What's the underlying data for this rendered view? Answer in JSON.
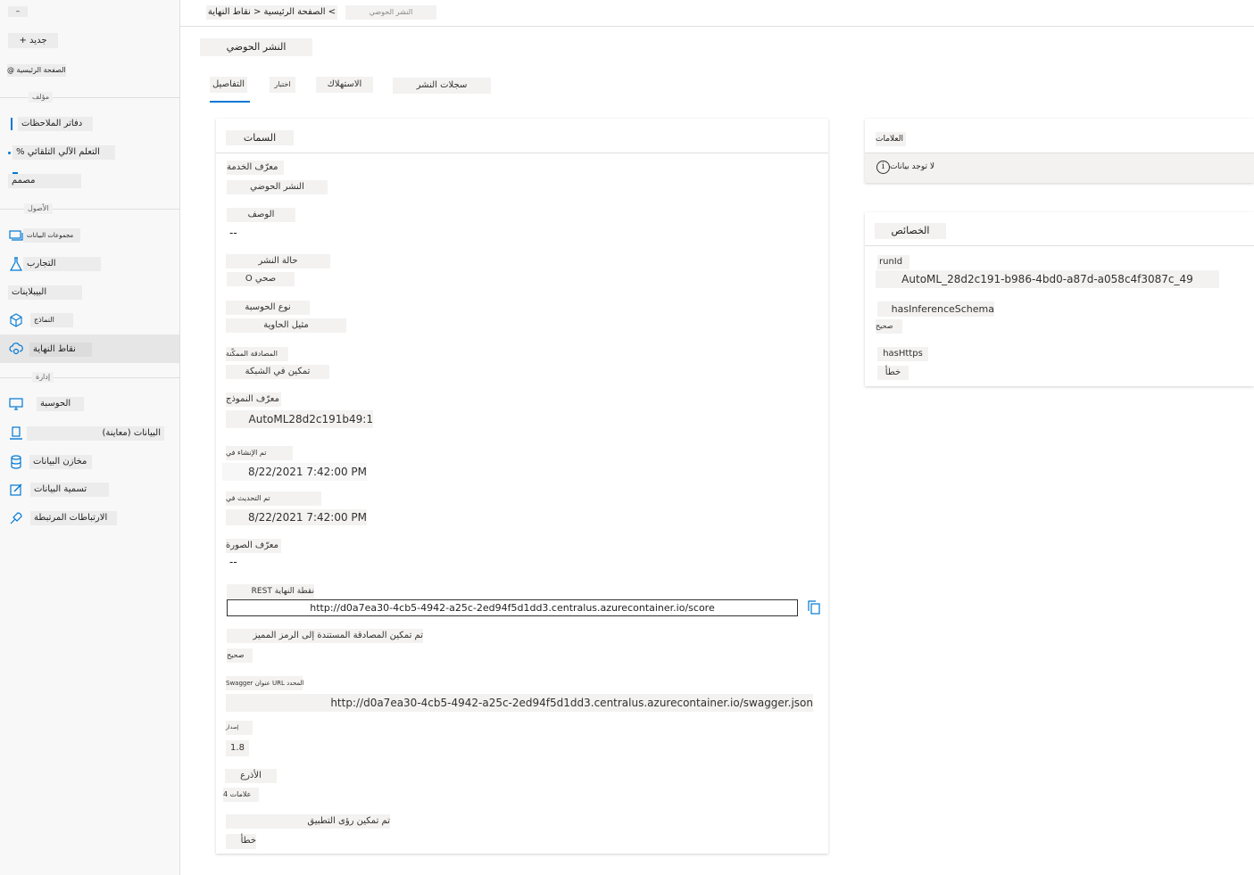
{
  "sidebar": {
    "collapse": "–",
    "new_button": "+ جديد",
    "home": "@ الصفحة الرئيسية",
    "section_author": "مؤلف",
    "items_author": [
      {
        "label": "دفاتر الملاحظات",
        "icon": "notebook-icon"
      },
      {
        "label": "% التعلم الآلي التلقائي",
        "icon": "automl-icon"
      },
      {
        "label": "مصمم",
        "icon": "designer-icon"
      }
    ],
    "section_assets": "الأصول",
    "items_assets": [
      {
        "label": "مجموعات البيانات",
        "icon": "datasets-icon"
      },
      {
        "label": "التجارب",
        "icon": "flask-icon"
      },
      {
        "label": "البيبلاينات",
        "icon": "pipeline-icon"
      },
      {
        "label": "النماذج",
        "icon": "cube-icon"
      },
      {
        "label": "نقاط النهاية",
        "icon": "endpoint-icon"
      }
    ],
    "section_manage": "إدارة",
    "items_manage": [
      {
        "label": "الحوسبة",
        "icon": "compute-icon"
      },
      {
        "label": "البيانات (معاينة)",
        "icon": "kubernetes-icon"
      },
      {
        "label": "مخازن البيانات",
        "icon": "datastore-icon"
      },
      {
        "label": "تسمية البيانات",
        "icon": "labeling-icon"
      },
      {
        "label": "الارتباطات المرتبطة",
        "icon": "linked-icon"
      }
    ]
  },
  "breadcrumb": {
    "path": "الصفحة الرئيسية < نقاط النهاية <",
    "current": "النشر الحوضي"
  },
  "page_title": "النشر الحوضي",
  "tabs": [
    "التفاصيل",
    "اختبار",
    "الاستهلاك",
    "سجلات النشر"
  ],
  "attributes_card": {
    "title": "السمات",
    "fields": [
      {
        "label": "معرّف الخدمة",
        "value": "النشر الحوضي"
      },
      {
        "label": "الوصف",
        "value": "--"
      },
      {
        "label": "حالة النشر",
        "value": "O صحي"
      },
      {
        "label": "نوع الحوسبة",
        "value": "مثيل الحاوية"
      },
      {
        "label": "المصادقة الممكّنة",
        "value": "تمكين في الشبكة"
      },
      {
        "label": "معرّف النموذج",
        "value": "AutoML28d2c191b49:1"
      },
      {
        "label": "تم الإنشاء في",
        "value": "8/22/2021 7:42:00 PM"
      },
      {
        "label": "تم التحديث في",
        "value": "8/22/2021 7:42:00 PM"
      },
      {
        "label": "معرّف الصورة",
        "value": "--"
      },
      {
        "label": "REST نقطة النهاية",
        "value": "http://d0a7ea30-4cb5-4942-a25c-2ed94f5d1dd3.centralus.azurecontainer.io/score"
      },
      {
        "label": "تم تمكين المصادقة المستندة إلى الرمز المميز",
        "value": "صحيح"
      },
      {
        "label": "Swagger عنوان URL المحدد",
        "value": "http://d0a7ea30-4cb5-4942-a25c-2ed94f5d1dd3.centralus.azurecontainer.io/swagger.json"
      },
      {
        "label": "إصدار",
        "value": "1.8"
      },
      {
        "label": "الأذرع",
        "value": "4 علامات"
      },
      {
        "label": "تم تمكين رؤى التطبيق",
        "value": "خطأ"
      }
    ]
  },
  "tags_card": {
    "title": "العلامات",
    "empty_text": "لا توجد بيانات"
  },
  "properties_card": {
    "title": "الخصائص",
    "fields": [
      {
        "label": "runId",
        "value": "AutoML_28d2c191-b986-4bd0-a87d-a058c4f3087c_49"
      },
      {
        "label": "hasInferenceSchema",
        "value": "صحيح"
      },
      {
        "label": "hasHttps",
        "value": "خطأ"
      }
    ]
  }
}
